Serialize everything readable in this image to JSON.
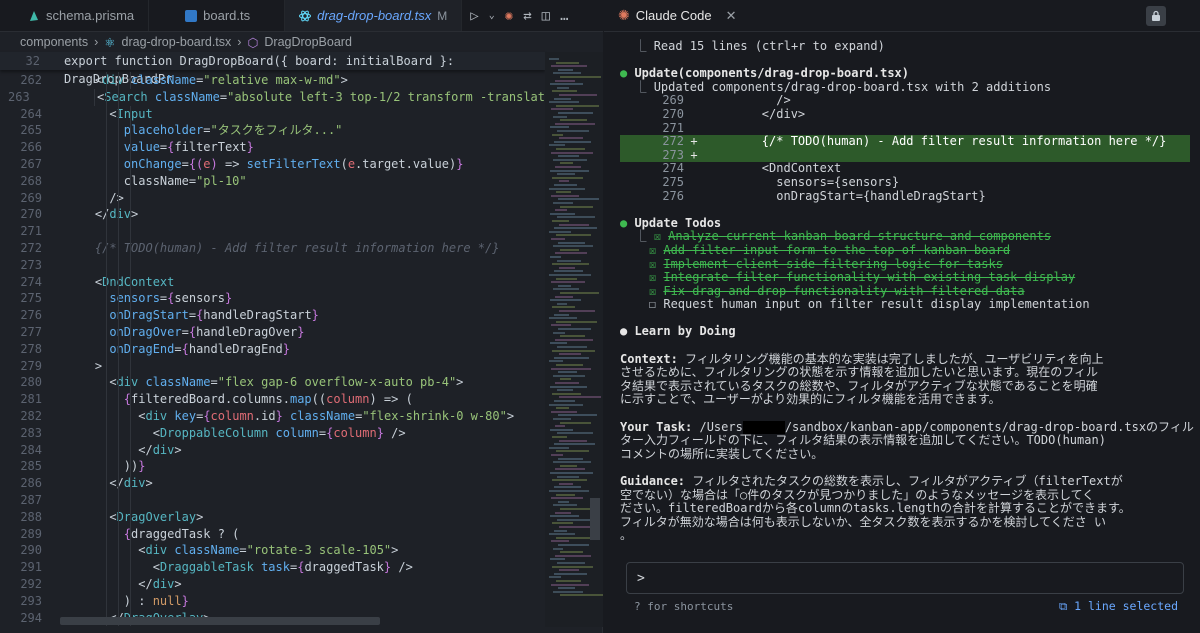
{
  "tabs": [
    {
      "label": "schema.prisma",
      "icon": "prisma-icon"
    },
    {
      "label": "board.ts",
      "icon": "ts-file-icon"
    },
    {
      "label": "drag-drop-board.tsx",
      "icon": "react-file-icon",
      "modified": "M"
    }
  ],
  "right_tab": {
    "label": "Claude Code"
  },
  "breadcrumb": {
    "folder": "components",
    "file": "drag-drop-board.tsx",
    "symbol": "DragDropBoard"
  },
  "sticky": {
    "num": "32",
    "code": "export function DragDropBoard({ board: initialBoard }: DragDropBoardPr"
  },
  "code_lines": [
    {
      "n": "262",
      "segs": [
        [
          "w",
          "    <"
        ],
        [
          "t",
          "div"
        ],
        [
          "a",
          " className"
        ],
        [
          "w",
          "="
        ],
        [
          "s",
          "\"relative max-w-md\""
        ],
        [
          "w",
          ">"
        ]
      ]
    },
    {
      "n": "263",
      "segs": [
        [
          "w",
          "      <"
        ],
        [
          "t",
          "Search"
        ],
        [
          "a",
          " className"
        ],
        [
          "w",
          "="
        ],
        [
          "s",
          "\"absolute left-3 top-1/2 transform -translat"
        ]
      ]
    },
    {
      "n": "264",
      "segs": [
        [
          "w",
          "      <"
        ],
        [
          "t",
          "Input"
        ]
      ]
    },
    {
      "n": "265",
      "segs": [
        [
          "a",
          "        placeholder"
        ],
        [
          "w",
          "="
        ],
        [
          "s",
          "\"タスクをフィルタ...\""
        ]
      ]
    },
    {
      "n": "266",
      "segs": [
        [
          "a",
          "        value"
        ],
        [
          "w",
          "="
        ],
        [
          "k",
          "{"
        ],
        [
          "w",
          "filterText"
        ],
        [
          "k",
          "}"
        ]
      ]
    },
    {
      "n": "267",
      "segs": [
        [
          "a",
          "        onChange"
        ],
        [
          "w",
          "="
        ],
        [
          "k",
          "{("
        ],
        [
          "v",
          "e"
        ],
        [
          "k",
          ")"
        ],
        [
          "w",
          " => "
        ],
        [
          "f",
          "setFilterText"
        ],
        [
          "w",
          "("
        ],
        [
          "v",
          "e"
        ],
        [
          "w",
          ".target.value)"
        ],
        [
          "k",
          "}"
        ]
      ]
    },
    {
      "n": "268",
      "segs": [
        [
          "w",
          "        className"
        ],
        [
          "w",
          "="
        ],
        [
          "s",
          "\"pl-10\""
        ]
      ]
    },
    {
      "n": "269",
      "segs": [
        [
          "w",
          "      />"
        ]
      ]
    },
    {
      "n": "270",
      "segs": [
        [
          "w",
          "    </"
        ],
        [
          "t",
          "div"
        ],
        [
          "w",
          ">"
        ]
      ]
    },
    {
      "n": "271",
      "segs": [
        [
          "w",
          ""
        ]
      ]
    },
    {
      "n": "272",
      "segs": [
        [
          "c",
          "    {/* TODO(human) - Add filter result information here */}"
        ]
      ]
    },
    {
      "n": "273",
      "segs": [
        [
          "w",
          ""
        ]
      ]
    },
    {
      "n": "274",
      "segs": [
        [
          "w",
          "    <"
        ],
        [
          "t",
          "DndContext"
        ]
      ]
    },
    {
      "n": "275",
      "segs": [
        [
          "a",
          "      sensors"
        ],
        [
          "w",
          "="
        ],
        [
          "k",
          "{"
        ],
        [
          "w",
          "sensors"
        ],
        [
          "k",
          "}"
        ]
      ]
    },
    {
      "n": "276",
      "segs": [
        [
          "a",
          "      onDragStart"
        ],
        [
          "w",
          "="
        ],
        [
          "k",
          "{"
        ],
        [
          "w",
          "handleDragStart"
        ],
        [
          "k",
          "}"
        ]
      ]
    },
    {
      "n": "277",
      "segs": [
        [
          "a",
          "      onDragOver"
        ],
        [
          "w",
          "="
        ],
        [
          "k",
          "{"
        ],
        [
          "w",
          "handleDragOver"
        ],
        [
          "k",
          "}"
        ]
      ]
    },
    {
      "n": "278",
      "segs": [
        [
          "a",
          "      onDragEnd"
        ],
        [
          "w",
          "="
        ],
        [
          "k",
          "{"
        ],
        [
          "w",
          "handleDragEnd"
        ],
        [
          "k",
          "}"
        ]
      ]
    },
    {
      "n": "279",
      "segs": [
        [
          "w",
          "    >"
        ]
      ]
    },
    {
      "n": "280",
      "segs": [
        [
          "w",
          "      <"
        ],
        [
          "t",
          "div"
        ],
        [
          "a",
          " className"
        ],
        [
          "w",
          "="
        ],
        [
          "s",
          "\"flex gap-6 overflow-x-auto pb-4\""
        ],
        [
          "w",
          ">"
        ]
      ]
    },
    {
      "n": "281",
      "segs": [
        [
          "k",
          "        {"
        ],
        [
          "w",
          "filteredBoard.columns."
        ],
        [
          "f",
          "map"
        ],
        [
          "w",
          "(("
        ],
        [
          "v",
          "column"
        ],
        [
          "w",
          ") => ("
        ]
      ]
    },
    {
      "n": "282",
      "segs": [
        [
          "w",
          "          <"
        ],
        [
          "t",
          "div"
        ],
        [
          "a",
          " key"
        ],
        [
          "w",
          "="
        ],
        [
          "k",
          "{"
        ],
        [
          "v",
          "column"
        ],
        [
          "w",
          ".id"
        ],
        [
          "k",
          "}"
        ],
        [
          "a",
          " className"
        ],
        [
          "w",
          "="
        ],
        [
          "s",
          "\"flex-shrink-0 w-80\""
        ],
        [
          "w",
          ">"
        ]
      ]
    },
    {
      "n": "283",
      "segs": [
        [
          "w",
          "            <"
        ],
        [
          "t",
          "DroppableColumn"
        ],
        [
          "a",
          " column"
        ],
        [
          "w",
          "="
        ],
        [
          "k",
          "{"
        ],
        [
          "v",
          "column"
        ],
        [
          "k",
          "}"
        ],
        [
          "w",
          " />"
        ]
      ]
    },
    {
      "n": "284",
      "segs": [
        [
          "w",
          "          </"
        ],
        [
          "t",
          "div"
        ],
        [
          "w",
          ">"
        ]
      ]
    },
    {
      "n": "285",
      "segs": [
        [
          "w",
          "        ))"
        ],
        [
          "k",
          "}"
        ]
      ]
    },
    {
      "n": "286",
      "segs": [
        [
          "w",
          "      </"
        ],
        [
          "t",
          "div"
        ],
        [
          "w",
          ">"
        ]
      ]
    },
    {
      "n": "287",
      "segs": [
        [
          "w",
          ""
        ]
      ]
    },
    {
      "n": "288",
      "segs": [
        [
          "w",
          "      <"
        ],
        [
          "t",
          "DragOverlay"
        ],
        [
          "w",
          ">"
        ]
      ]
    },
    {
      "n": "289",
      "segs": [
        [
          "k",
          "        {"
        ],
        [
          "w",
          "draggedTask ? ("
        ]
      ]
    },
    {
      "n": "290",
      "segs": [
        [
          "w",
          "          <"
        ],
        [
          "t",
          "div"
        ],
        [
          "a",
          " className"
        ],
        [
          "w",
          "="
        ],
        [
          "s",
          "\"rotate-3 scale-105\""
        ],
        [
          "w",
          ">"
        ]
      ]
    },
    {
      "n": "291",
      "segs": [
        [
          "w",
          "            <"
        ],
        [
          "t",
          "DraggableTask"
        ],
        [
          "a",
          " task"
        ],
        [
          "w",
          "="
        ],
        [
          "k",
          "{"
        ],
        [
          "w",
          "draggedTask"
        ],
        [
          "k",
          "}"
        ],
        [
          "w",
          " />"
        ]
      ]
    },
    {
      "n": "292",
      "segs": [
        [
          "w",
          "          </"
        ],
        [
          "t",
          "div"
        ],
        [
          "w",
          ">"
        ]
      ]
    },
    {
      "n": "293",
      "segs": [
        [
          "w",
          "        ) : "
        ],
        [
          "p",
          "null"
        ],
        [
          "k",
          "}"
        ]
      ]
    },
    {
      "n": "294",
      "segs": [
        [
          "w",
          "      </"
        ],
        [
          "t",
          "DragOverlay"
        ],
        [
          "w",
          ">"
        ]
      ]
    }
  ],
  "claude": {
    "read": "Read 15 lines (ctrl+r to expand)",
    "update_title": "Update(components/drag-drop-board.tsx)",
    "update_summary": "Updated components/drag-drop-board.tsx with 2 additions",
    "diff": [
      {
        "n": "269",
        "mark": "",
        "code": "          />"
      },
      {
        "n": "270",
        "mark": "",
        "code": "        </div>"
      },
      {
        "n": "271",
        "mark": "",
        "code": ""
      },
      {
        "n": "272",
        "mark": "+",
        "code": "        {/* TODO(human) - Add filter result information here */}",
        "add": true
      },
      {
        "n": "273",
        "mark": "+",
        "code": "",
        "add": true
      },
      {
        "n": "274",
        "mark": "",
        "code": "        <DndContext"
      },
      {
        "n": "275",
        "mark": "",
        "code": "          sensors={sensors}"
      },
      {
        "n": "276",
        "mark": "",
        "code": "          onDragStart={handleDragStart}"
      }
    ],
    "todos_title": "Update Todos",
    "todos": [
      {
        "label": "Analyze current kanban board structure and components",
        "done": true
      },
      {
        "label": "Add filter input form to the top of kanban board",
        "done": true
      },
      {
        "label": "Implement client-side filtering logic for tasks",
        "done": true
      },
      {
        "label": "Integrate filter functionality with existing task display",
        "done": true
      },
      {
        "label": "Fix drag and drop functionality with filtered data",
        "done": true
      },
      {
        "label": "Request human input on filter result display implementation",
        "done": false
      }
    ],
    "learn_title": "● Learn by Doing",
    "context_label": "Context:",
    "context_lines": [
      " フィルタリング機能の基本的な実装は完了しましたが、ユーザビリティを向上",
      "させるために、フィルタリングの状態を示す情報を追加したいと思います。現在のフィル",
      "タ結果で表示されているタスクの総数や、フィルタがアクティブな状態であることを明確",
      "に示すことで、ユーザーがより効果的にフィルタ機能を活用できます。"
    ],
    "task_label": "Your Task:",
    "task_pre": " /Users",
    "task_post": "/sandbox/kanban-app/components/drag-drop-board.tsxのフィル",
    "task_lines": [
      "ター入力フィールドの下に、フィルタ結果の表示情報を追加してください。TODO(human)",
      "コメントの場所に実装してください。"
    ],
    "guidance_label": "Guidance:",
    "guidance_lines": [
      " フィルタされたタスクの総数を表示し、フィルタがアクティブ（filterTextが",
      "空でない）な場合は「○件のタスクが見つかりました」のようなメッセージを表示してく",
      "ださい。filteredBoardから各columnのtasks.lengthの合計を計算することができます。",
      "フィルタが無効な場合は何も表示しないか、全タスク数を表示するかを検討してくださ い",
      "。"
    ],
    "prompt": ">",
    "hint": "? for shortcuts",
    "selection": "1 line selected"
  }
}
